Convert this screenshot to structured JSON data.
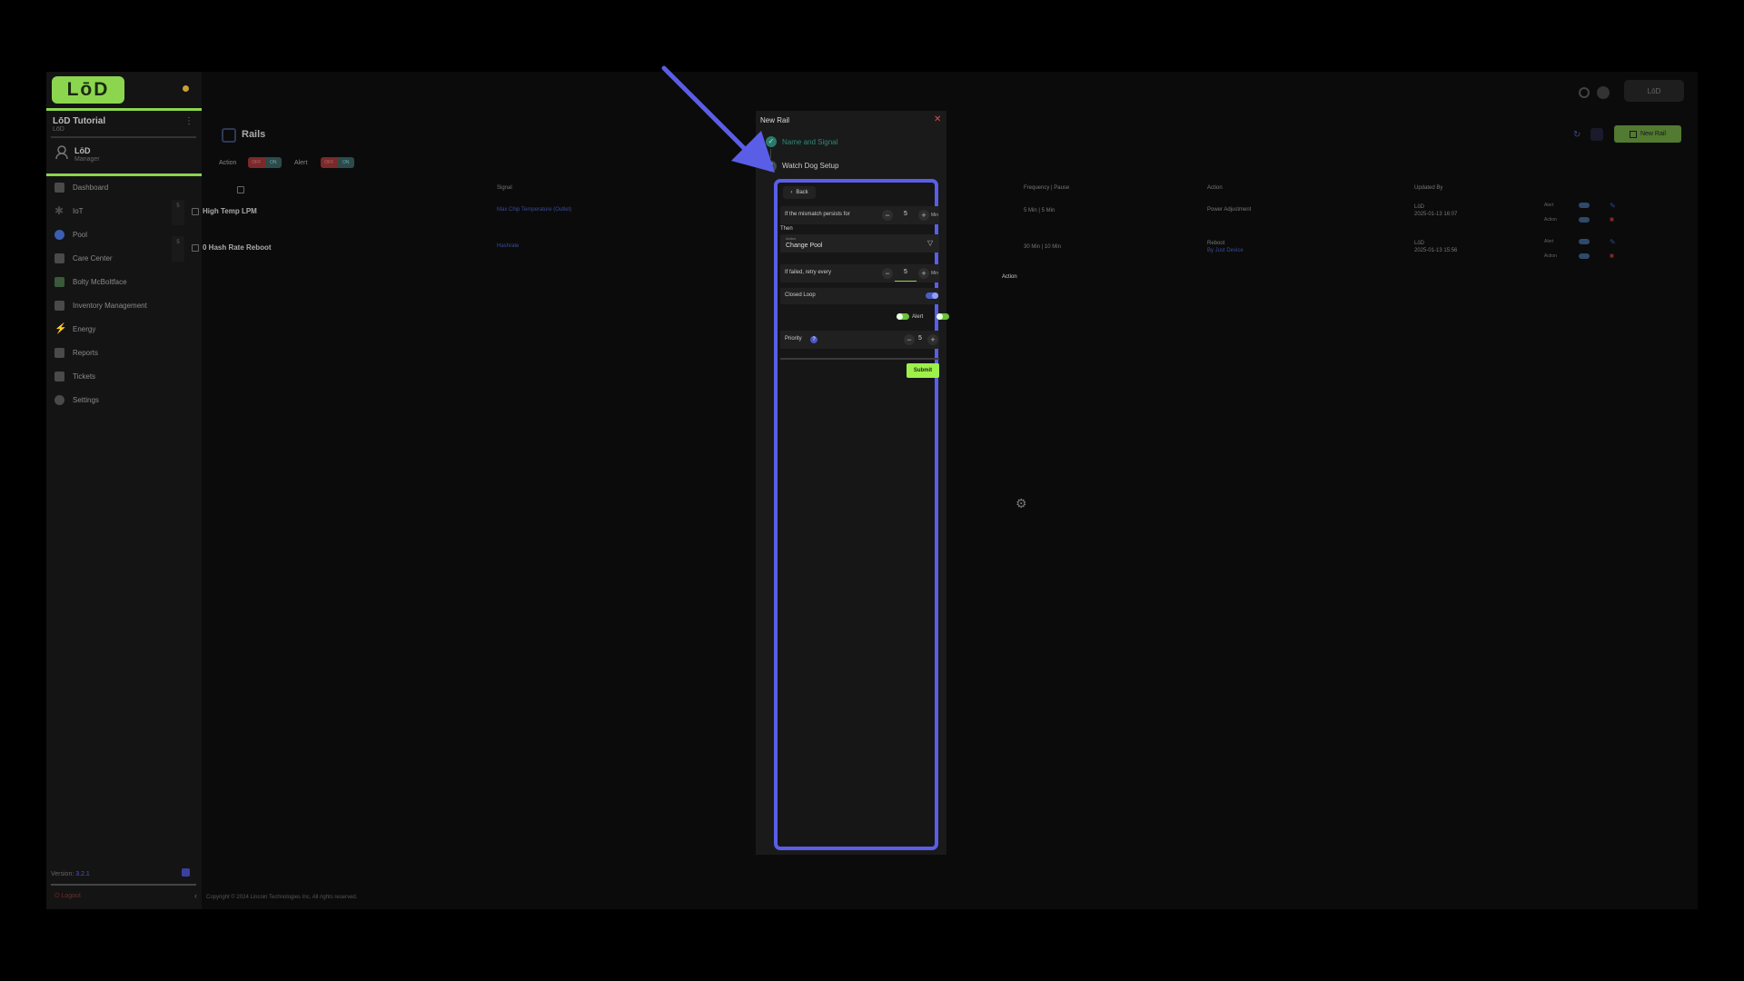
{
  "sidebar": {
    "logo": "LōD",
    "org_name": "LōD Tutorial",
    "org_sub": "LōD",
    "user_name": "LōD",
    "user_role": "Manager",
    "items": [
      {
        "label": "Dashboard",
        "icon": "dashboard-icon"
      },
      {
        "label": "IoT",
        "icon": "iot-icon"
      },
      {
        "label": "Pool",
        "icon": "pool-icon"
      },
      {
        "label": "Care Center",
        "icon": "care-center-icon"
      },
      {
        "label": "Bolty McBoltface",
        "icon": "bot-icon"
      },
      {
        "label": "Inventory Management",
        "icon": "inventory-icon"
      },
      {
        "label": "Energy",
        "icon": "bolt-icon"
      },
      {
        "label": "Reports",
        "icon": "reports-icon"
      },
      {
        "label": "Tickets",
        "icon": "tickets-icon"
      },
      {
        "label": "Settings",
        "icon": "settings-icon"
      }
    ],
    "version_label": "Version:",
    "version": "3.2.1",
    "logout": "Logout"
  },
  "topbar": {
    "user_chip": "LōD"
  },
  "page": {
    "title": "Rails",
    "filters": [
      {
        "label": "Action",
        "off": "OFF",
        "on": "ON"
      },
      {
        "label": "Alert",
        "off": "OFF",
        "on": "ON"
      }
    ],
    "new_button": "New Rail",
    "columns": [
      "Signal",
      "Frequency | Pause",
      "Action",
      "Updated By"
    ],
    "rows": [
      {
        "idx": "5",
        "name": "High Temp LPM",
        "signal": "Max Chip Temperature (Outlet)",
        "frequency": "5 Min | 5 Min",
        "action": "Power Adjustment",
        "action_sub": "",
        "updated_by": "LōD",
        "updated_at": "2025-01-13 16:07",
        "alert": "Alert",
        "action_toggle": "Action"
      },
      {
        "idx": "5",
        "name": "0 Hash Rate Reboot",
        "signal": "Hashrate",
        "frequency": "30 Min | 10 Min",
        "action": "Reboot",
        "action_sub": "By Just Device",
        "updated_by": "LōD",
        "updated_at": "2025-01-13 15:56",
        "alert": "Alert",
        "action_toggle": "Action"
      }
    ],
    "copyright": "Copyright © 2024 Lincoin Technologies Inc. All rights reserved."
  },
  "modal": {
    "title": "New Rail",
    "steps": [
      {
        "label": "Name and Signal",
        "status": "done"
      },
      {
        "label": "Watch Dog Setup",
        "status": "active",
        "number": "2"
      }
    ],
    "back": "Back",
    "mismatch_label": "If the mismatch persists for",
    "mismatch_value": "5",
    "unit": "Min",
    "then_label": "Then",
    "action_field_label": "Action",
    "action_value": "Change Pool",
    "retry_label": "If failed, retry every",
    "retry_value": "5",
    "closed_loop_label": "Closed Loop",
    "alert_label": "Alert",
    "action_label": "Action",
    "priority_label": "Priority",
    "priority_value": "5",
    "submit": "Submit"
  }
}
